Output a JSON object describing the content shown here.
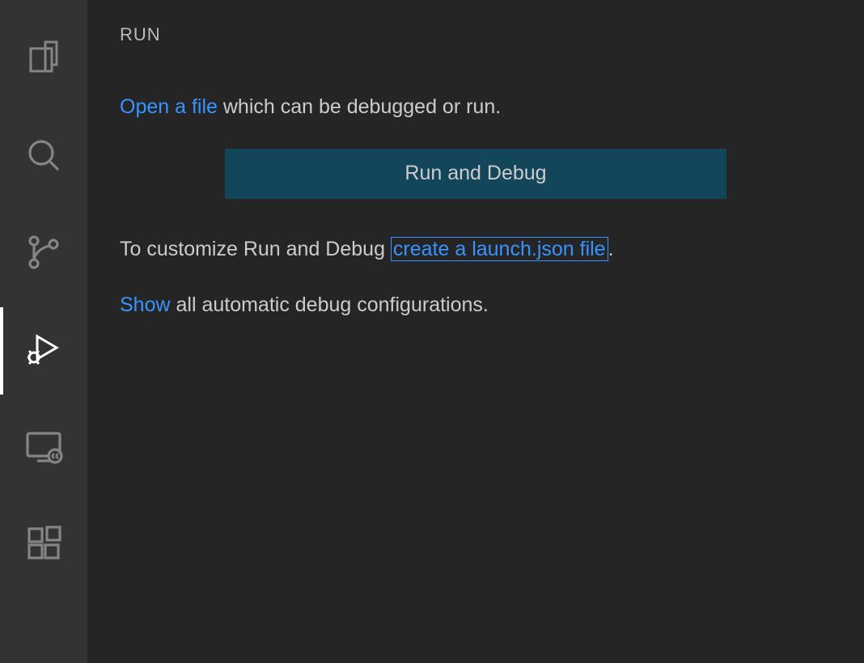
{
  "panel": {
    "title": "RUN",
    "open_file_link": "Open a file",
    "open_file_suffix": " which can be debugged or run.",
    "run_debug_button": "Run and Debug",
    "customize_prefix": "To customize Run and Debug ",
    "create_launch_link": "create a launch.json file",
    "customize_suffix": ".",
    "show_link": "Show",
    "show_suffix": " all automatic debug configurations."
  },
  "activity": {
    "explorer": "Explorer",
    "search": "Search",
    "source_control": "Source Control",
    "run_debug": "Run and Debug",
    "remote": "Remote Explorer",
    "extensions": "Extensions"
  }
}
